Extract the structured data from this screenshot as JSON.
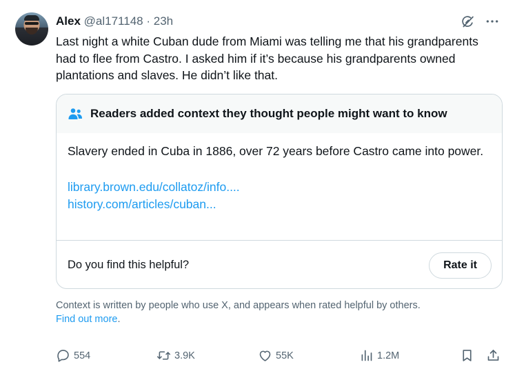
{
  "tweet": {
    "author_name": "Alex",
    "handle": "@al171148",
    "separator": "·",
    "time": "23h",
    "text": "Last night a white Cuban dude from Miami was telling me that his grandparents had to flee from Castro. I asked him if it’s because his grandparents owned plantations and slaves. He didn’t like that."
  },
  "community_note": {
    "header": "Readers added context they thought people might want to know",
    "body": "Slavery ended in Cuba in 1886, over 72 years before Castro came into power.",
    "links": [
      "library.brown.edu/collatoz/info....",
      "history.com/articles/cuban..."
    ],
    "helpful_question": "Do you find this helpful?",
    "rate_label": "Rate it"
  },
  "context": {
    "text": "Context is written by people who use X, and appears when rated helpful by others.",
    "link": "Find out more",
    "period": "."
  },
  "actions": {
    "replies": "554",
    "reposts": "3.9K",
    "likes": "55K",
    "views": "1.2M"
  },
  "icons": {
    "grok": "grok-icon",
    "more": "more-icon",
    "people": "people-icon",
    "reply": "reply-icon",
    "repost": "repost-icon",
    "like": "heart-icon",
    "views": "views-icon",
    "bookmark": "bookmark-icon",
    "share": "share-icon"
  },
  "colors": {
    "accent": "#1d9bf0",
    "muted": "#536471",
    "text": "#0f1419",
    "border": "#cfd9de"
  }
}
